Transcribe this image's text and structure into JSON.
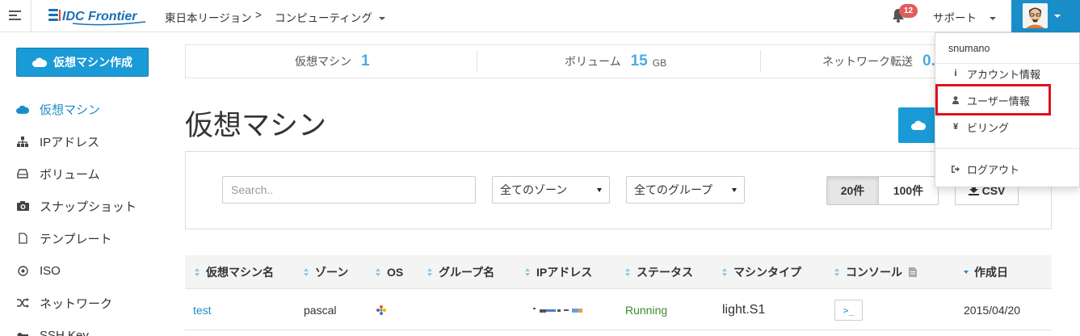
{
  "header": {
    "logo_text": "IDC Frontier",
    "region": "東日本リージョン",
    "separator": ">",
    "service": "コンピューティング",
    "notification_count": "12",
    "support": "サポート"
  },
  "sidebar": {
    "create_button": "仮想マシン作成",
    "items": [
      {
        "label": "仮想マシン",
        "icon": "cloud-icon"
      },
      {
        "label": "IPアドレス",
        "icon": "sitemap-icon"
      },
      {
        "label": "ボリューム",
        "icon": "hdd-icon"
      },
      {
        "label": "スナップショット",
        "icon": "camera-icon"
      },
      {
        "label": "テンプレート",
        "icon": "file-icon"
      },
      {
        "label": "ISO",
        "icon": "disc-icon"
      },
      {
        "label": "ネットワーク",
        "icon": "random-icon"
      },
      {
        "label": "SSH Key",
        "icon": "key-icon"
      }
    ]
  },
  "stats": {
    "vm_label": "仮想マシン",
    "vm_value": "1",
    "volume_label": "ボリューム",
    "volume_value": "15",
    "volume_unit": "GB",
    "network_label": "ネットワーク転送",
    "network_value": "0."
  },
  "main": {
    "title": "仮想マシン",
    "search_placeholder": "Search..",
    "zone_select": "全てのゾーン",
    "group_select": "全てのグループ",
    "page_20": "20件",
    "page_100": "100件",
    "csv": "CSV"
  },
  "table": {
    "headers": [
      "仮想マシン名",
      "ゾーン",
      "OS",
      "グループ名",
      "IPアドレス",
      "ステータス",
      "マシンタイプ",
      "コンソール",
      "作成日"
    ],
    "rows": [
      {
        "name": "test",
        "zone": "pascal",
        "os": "os-logo-icon",
        "group": "",
        "ip": "",
        "status": "Running",
        "type": "light.S1",
        "console": ">_",
        "created": "2015/04/20"
      }
    ]
  },
  "user_menu": {
    "username": "snumano",
    "account_info": "アカウント情報",
    "user_info": "ユーザー情報",
    "billing": "ビリング",
    "logout": "ログアウト"
  },
  "colors": {
    "accent": "#1a9ad6",
    "stat_number": "#4aaee0",
    "status_running": "#3c8a2e",
    "highlight": "#e0101e"
  }
}
